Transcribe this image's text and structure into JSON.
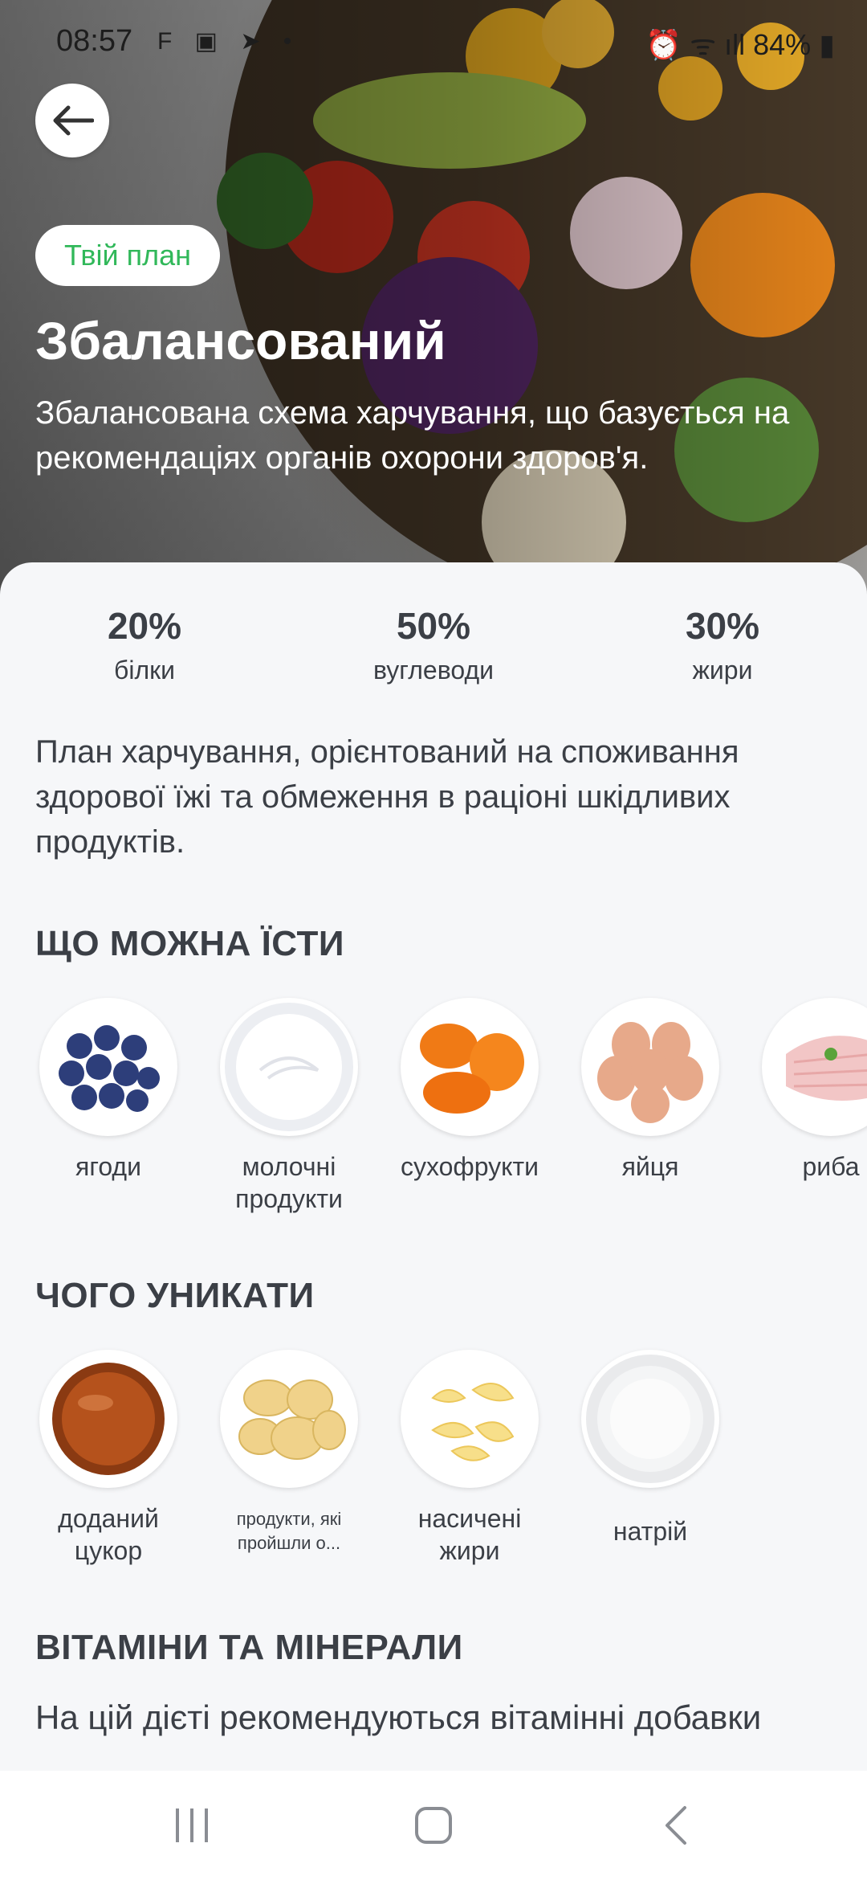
{
  "status_bar": {
    "time": "08:57",
    "battery": "84%"
  },
  "hero": {
    "chip": "Твій план",
    "title": "Збалансований",
    "description": "Збалансована схема харчування, що базується на рекомендаціях органів охорони здоров'я."
  },
  "macros": [
    {
      "value": "20%",
      "label": "білки"
    },
    {
      "value": "50%",
      "label": "вуглеводи"
    },
    {
      "value": "30%",
      "label": "жири"
    }
  ],
  "intro": "План харчування, орієнтований на споживання здорової їжі та обмеження в раціоні шкідливих продуктів.",
  "can_eat": {
    "title": "ЩО МОЖНА ЇСТИ",
    "items": [
      {
        "label": "ягоди",
        "icon": "blueberries"
      },
      {
        "label": "молочні продукти",
        "icon": "yogurt"
      },
      {
        "label": "сухофрукти",
        "icon": "dried-apricots"
      },
      {
        "label": "яйця",
        "icon": "eggs"
      },
      {
        "label": "риба",
        "icon": "fish"
      }
    ]
  },
  "avoid": {
    "title": "ЧОГО УНИКАТИ",
    "items": [
      {
        "label": "доданий цукор",
        "icon": "caramel"
      },
      {
        "label": "продукти, які пройшли о...",
        "icon": "chips"
      },
      {
        "label": "насичені жири",
        "icon": "butter"
      },
      {
        "label": "натрій",
        "icon": "salt"
      }
    ]
  },
  "vitamins": {
    "title": "ВІТАМІНИ ТА МІНЕРАЛИ",
    "text": "На цій дієті рекомендуються вітамінні добавки"
  },
  "colors": {
    "accent": "#31b85a",
    "text": "#3b3f46"
  }
}
